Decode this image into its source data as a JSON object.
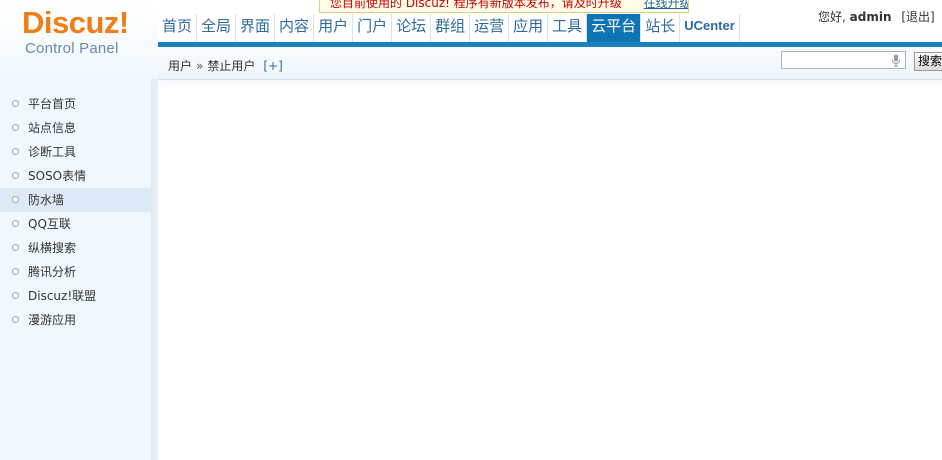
{
  "logo": {
    "brand": "Discuz!",
    "subtitle": "Control Panel"
  },
  "notice": {
    "message": "您目前使用的 Discuz! 程序有新版本发布，请及时升级",
    "link": "在线升级"
  },
  "nav": {
    "items": [
      {
        "label": "首页"
      },
      {
        "label": "全局"
      },
      {
        "label": "界面"
      },
      {
        "label": "内容"
      },
      {
        "label": "用户"
      },
      {
        "label": "门户"
      },
      {
        "label": "论坛"
      },
      {
        "label": "群组"
      },
      {
        "label": "运营"
      },
      {
        "label": "应用"
      },
      {
        "label": "工具"
      },
      {
        "label": "云平台",
        "active": true
      },
      {
        "label": "站长"
      },
      {
        "label": "UCenter"
      }
    ]
  },
  "user": {
    "greeting": "您好,",
    "name": "admin",
    "logout": "[退出]"
  },
  "breadcrumb": {
    "parent": "用户",
    "separator": "»",
    "current": "禁止用户",
    "add": "[+]"
  },
  "search": {
    "value": "",
    "button": "搜索"
  },
  "sidebar": {
    "items": [
      {
        "label": "平台首页"
      },
      {
        "label": "站点信息"
      },
      {
        "label": "诊断工具"
      },
      {
        "label": "SOSO表情"
      },
      {
        "label": "防水墙",
        "active": true
      },
      {
        "label": "QQ互联"
      },
      {
        "label": "纵横搜索"
      },
      {
        "label": "腾讯分析"
      },
      {
        "label": "Discuz!联盟"
      },
      {
        "label": "漫游应用"
      }
    ]
  },
  "colors": {
    "accent": "#1a82be",
    "brand": "#ef7d18",
    "nav_text": "#2d6aa0",
    "sidebar_bg": "#f1f8fd"
  }
}
